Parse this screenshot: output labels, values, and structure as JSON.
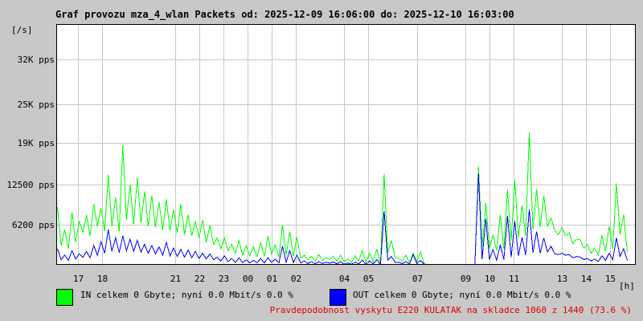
{
  "title": "Graf provozu mza_4_wlan Packets od: 2025-12-09 16:06:00 do: 2025-12-10 16:03:00",
  "y_unit": "[/s]",
  "x_unit": "[h]",
  "legend": {
    "in_text": "IN celkem 0 Gbyte; nyní   0.0 Mbit/s 0.0 %",
    "out_text": "OUT celkem 0 Gbyte; nyní   0.0 Mbit/s 0.0 %",
    "in_color": "#00ff00",
    "out_color": "#0000ff"
  },
  "footer_text": "Pravdepodobnost vyskytu E220 KULATAK na skladce 1060 z 1440 (73.6 %)",
  "chart_data": {
    "type": "line",
    "title": "Graf provozu mza_4_wlan Packets od: 2025-12-09 16:06:00 do: 2025-12-10 16:03:00",
    "xlabel": "[h]",
    "ylabel": "[/s]",
    "x_tick_labels": [
      "17",
      "18",
      "21",
      "22",
      "23",
      "00",
      "01",
      "02",
      "04",
      "05",
      "07",
      "09",
      "10",
      "11",
      "13",
      "14",
      "15"
    ],
    "x_tick_hours": [
      17,
      18,
      21,
      22,
      23,
      24,
      25,
      26,
      28,
      29,
      31,
      33,
      34,
      35,
      37,
      38,
      39
    ],
    "y_ticks": [
      {
        "value": 6200,
        "label": "6200 pps"
      },
      {
        "value": 12500,
        "label": "12500 pps"
      },
      {
        "value": 19000,
        "label": "19K pps"
      },
      {
        "value": 25000,
        "label": "25K pps"
      },
      {
        "value": 32000,
        "label": "32K pps"
      }
    ],
    "ylim": [
      0,
      37500
    ],
    "xlim_hours": [
      16.1,
      40.05
    ],
    "grid": true,
    "series": [
      {
        "name": "IN",
        "color": "#00ff00",
        "x_hours": [
          16.15,
          16.3,
          16.45,
          16.6,
          16.75,
          16.9,
          17.05,
          17.2,
          17.35,
          17.5,
          17.65,
          17.8,
          17.95,
          18.1,
          18.25,
          18.4,
          18.55,
          18.7,
          18.85,
          19.0,
          19.15,
          19.3,
          19.45,
          19.6,
          19.75,
          19.9,
          20.05,
          20.2,
          20.35,
          20.5,
          20.65,
          20.8,
          20.95,
          21.1,
          21.25,
          21.4,
          21.55,
          21.7,
          21.85,
          22.0,
          22.15,
          22.3,
          22.45,
          22.6,
          22.75,
          22.9,
          23.05,
          23.2,
          23.35,
          23.5,
          23.65,
          23.8,
          23.95,
          24.1,
          24.25,
          24.4,
          24.55,
          24.7,
          24.85,
          25.0,
          25.15,
          25.3,
          25.45,
          25.6,
          25.75,
          25.9,
          26.05,
          26.2,
          26.35,
          26.5,
          26.65,
          26.8,
          26.95,
          27.1,
          27.25,
          27.4,
          27.55,
          27.7,
          27.85,
          28.0,
          28.15,
          28.3,
          28.45,
          28.6,
          28.75,
          28.9,
          29.05,
          29.2,
          29.35,
          29.5,
          29.65,
          29.8,
          29.95,
          30.1,
          30.25,
          30.4,
          30.55,
          30.7,
          30.85,
          31.0,
          31.15,
          31.3,
          31.45,
          31.6,
          31.75,
          31.9,
          32.05,
          32.2,
          32.35,
          32.5,
          32.65,
          32.8,
          32.95,
          33.1,
          33.25,
          33.4,
          33.55,
          33.7,
          33.85,
          34.0,
          34.15,
          34.3,
          34.45,
          34.6,
          34.75,
          34.9,
          35.05,
          35.2,
          35.35,
          35.5,
          35.65,
          35.8,
          35.95,
          36.1,
          36.25,
          36.4,
          36.55,
          36.7,
          36.85,
          37.0,
          37.15,
          37.3,
          37.45,
          37.6,
          37.75,
          37.9,
          38.05,
          38.2,
          38.35,
          38.5,
          38.65,
          38.8,
          38.95,
          39.1,
          39.25,
          39.4,
          39.55,
          39.7
        ],
        "values": [
          9000,
          3000,
          5500,
          2500,
          8200,
          3500,
          6800,
          5000,
          7800,
          4500,
          9400,
          6000,
          8800,
          5200,
          14000,
          6000,
          10500,
          5200,
          18600,
          7000,
          12500,
          6300,
          13500,
          6500,
          11400,
          6000,
          10800,
          5800,
          9800,
          5400,
          10200,
          5300,
          8600,
          5000,
          9500,
          4700,
          7800,
          4500,
          6800,
          4200,
          7000,
          3500,
          6100,
          3200,
          4200,
          2500,
          4200,
          2200,
          3200,
          1800,
          3800,
          1500,
          3000,
          1400,
          2800,
          1300,
          3500,
          1300,
          4500,
          1700,
          3100,
          1200,
          6200,
          1500,
          5200,
          1300,
          4300,
          1100,
          1500,
          800,
          1300,
          600,
          1600,
          700,
          1100,
          900,
          1300,
          600,
          1500,
          500,
          900,
          400,
          1400,
          600,
          2200,
          400,
          1800,
          500,
          2500,
          0,
          14200,
          1800,
          3800,
          1200,
          1000,
          600,
          1500,
          300,
          1800,
          500,
          2000,
          200,
          0,
          0,
          0,
          0,
          0,
          0,
          0,
          0,
          0,
          0,
          0,
          0,
          0,
          0,
          15300,
          2800,
          9700,
          2500,
          4700,
          2200,
          7800,
          2500,
          11700,
          3800,
          13200,
          4200,
          9300,
          4500,
          20600,
          5500,
          11800,
          5800,
          10800,
          6000,
          7300,
          5400,
          4700,
          5800,
          4500,
          5000,
          3300,
          4000,
          3900,
          2600,
          3200,
          1800,
          2600,
          1500,
          4600,
          2100,
          6000,
          2500,
          12700,
          4700,
          7800,
          2000,
          1500,
          800
        ],
        "gaps_after_hours": [
          31.3
        ],
        "gap_end_hours": [
          33.0
        ]
      },
      {
        "name": "OUT",
        "color": "#0000ff",
        "x_hours": [
          16.15,
          16.3,
          16.45,
          16.6,
          16.75,
          16.9,
          17.05,
          17.2,
          17.35,
          17.5,
          17.65,
          17.8,
          17.95,
          18.1,
          18.25,
          18.4,
          18.55,
          18.7,
          18.85,
          19.0,
          19.15,
          19.3,
          19.45,
          19.6,
          19.75,
          19.9,
          20.05,
          20.2,
          20.35,
          20.5,
          20.65,
          20.8,
          20.95,
          21.1,
          21.25,
          21.4,
          21.55,
          21.7,
          21.85,
          22.0,
          22.15,
          22.3,
          22.45,
          22.6,
          22.75,
          22.9,
          23.05,
          23.2,
          23.35,
          23.5,
          23.65,
          23.8,
          23.95,
          24.1,
          24.25,
          24.4,
          24.55,
          24.7,
          24.85,
          25.0,
          25.15,
          25.3,
          25.45,
          25.6,
          25.75,
          25.9,
          26.05,
          26.2,
          26.35,
          26.5,
          26.65,
          26.8,
          26.95,
          27.1,
          27.25,
          27.4,
          27.55,
          27.7,
          27.85,
          28.0,
          28.15,
          28.3,
          28.45,
          28.6,
          28.75,
          28.9,
          29.05,
          29.2,
          29.35,
          29.5,
          29.65,
          29.8,
          29.95,
          30.1,
          30.25,
          30.4,
          30.55,
          30.7,
          30.85,
          31.0,
          31.15,
          31.3,
          31.45,
          31.6,
          31.75,
          31.9,
          32.05,
          32.2,
          32.35,
          32.5,
          32.65,
          32.8,
          32.95,
          33.1,
          33.25,
          33.4,
          33.55,
          33.7,
          33.85,
          34.0,
          34.15,
          34.3,
          34.45,
          34.6,
          34.75,
          34.9,
          35.05,
          35.2,
          35.35,
          35.5,
          35.65,
          35.8,
          35.95,
          36.1,
          36.25,
          36.4,
          36.55,
          36.7,
          36.85,
          37.0,
          37.15,
          37.3,
          37.45,
          37.6,
          37.75,
          37.9,
          38.05,
          38.2,
          38.35,
          38.5,
          38.65,
          38.8,
          38.95,
          39.1,
          39.25,
          39.4,
          39.55,
          39.7
        ],
        "values": [
          2500,
          800,
          1500,
          700,
          2200,
          900,
          1700,
          1200,
          2100,
          1100,
          3000,
          1500,
          3600,
          1800,
          5500,
          2100,
          4200,
          1900,
          4500,
          2200,
          4000,
          2100,
          3800,
          2000,
          3200,
          1800,
          3000,
          1700,
          2800,
          1500,
          3500,
          1400,
          2600,
          1300,
          2400,
          1200,
          2300,
          1100,
          2100,
          1000,
          1800,
          900,
          1700,
          800,
          1200,
          600,
          1400,
          500,
          1000,
          400,
          1100,
          350,
          800,
          300,
          700,
          300,
          1000,
          300,
          1100,
          400,
          900,
          300,
          2900,
          400,
          2200,
          350,
          1500,
          300,
          600,
          200,
          500,
          150,
          500,
          200,
          400,
          250,
          450,
          150,
          500,
          100,
          300,
          100,
          400,
          150,
          700,
          100,
          600,
          150,
          800,
          0,
          8400,
          700,
          1300,
          400,
          400,
          200,
          500,
          100,
          1600,
          200,
          700,
          100,
          0,
          0,
          0,
          0,
          0,
          0,
          0,
          0,
          0,
          0,
          0,
          0,
          0,
          0,
          14200,
          900,
          7200,
          800,
          2400,
          700,
          3100,
          800,
          7600,
          1200,
          6800,
          1400,
          4300,
          1500,
          8600,
          1900,
          5200,
          1800,
          4200,
          2000,
          2900,
          1700,
          1600,
          1800,
          1500,
          1600,
          1100,
          1300,
          1200,
          800,
          1000,
          600,
          900,
          500,
          1400,
          700,
          1800,
          800,
          4200,
          1300,
          2500,
          700,
          600,
          300
        ]
      }
    ]
  }
}
